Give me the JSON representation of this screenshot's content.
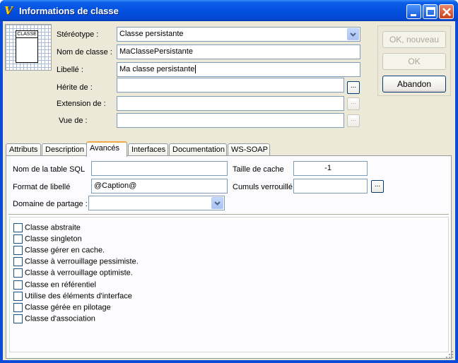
{
  "window": {
    "title": "Informations de classe",
    "icon": "app-logo-icon"
  },
  "icon_block": {
    "label": "CLASSE"
  },
  "form": {
    "stereotype_label": "Stéréotype :",
    "stereotype_value": "Classe persistante",
    "class_name_label": "Nom de classe :",
    "class_name_value": "MaClassePersistante",
    "libelle_label": "Libellé :",
    "libelle_value": "Ma classe persistante",
    "inherits_label": "Hérite de :",
    "inherits_value": "",
    "extension_label": "Extension de :",
    "extension_value": "",
    "view_label": "Vue de :",
    "view_value": "",
    "ellipsis": "..."
  },
  "buttons": {
    "ok_new": "OK, nouveau",
    "ok": "OK",
    "cancel": "Abandon"
  },
  "tabs": [
    {
      "label": "Attributs"
    },
    {
      "label": "Description"
    },
    {
      "label": "Avancés"
    },
    {
      "label": "Interfaces"
    },
    {
      "label": "Documentation"
    },
    {
      "label": "WS-SOAP"
    }
  ],
  "active_tab": "Avancés",
  "advanced": {
    "sql_table_label": "Nom de la table SQL",
    "sql_table_value": "",
    "cache_size_label": "Taille de cache",
    "cache_size_value": "-1",
    "caption_format_label": "Format de libellé",
    "caption_format_value": "@Caption@",
    "locked_totals_label": "Cumuls verrouillé",
    "locked_totals_value": "",
    "share_domain_label": "Domaine de partage :",
    "share_domain_value": ""
  },
  "checkboxes": [
    {
      "label": "Classe abstraite",
      "checked": false
    },
    {
      "label": "Classe singleton",
      "checked": false
    },
    {
      "label": "Classe gérer en cache.",
      "checked": false
    },
    {
      "label": "Classe à verrouillage pessimiste.",
      "checked": false
    },
    {
      "label": "Classe à verrouillage optimiste.",
      "checked": false
    },
    {
      "label": "Classe en référentiel",
      "checked": false
    },
    {
      "label": "Utilise des éléments d'interface",
      "checked": false
    },
    {
      "label": "Classe gérée en pilotage",
      "checked": false
    },
    {
      "label": "Classe d'association",
      "checked": false
    }
  ],
  "colors": {
    "titlebar": "#0551e0",
    "dialog_bg": "#ece9d8",
    "active_tab_accent": "#f2a94a",
    "field_border": "#7f9db9"
  }
}
